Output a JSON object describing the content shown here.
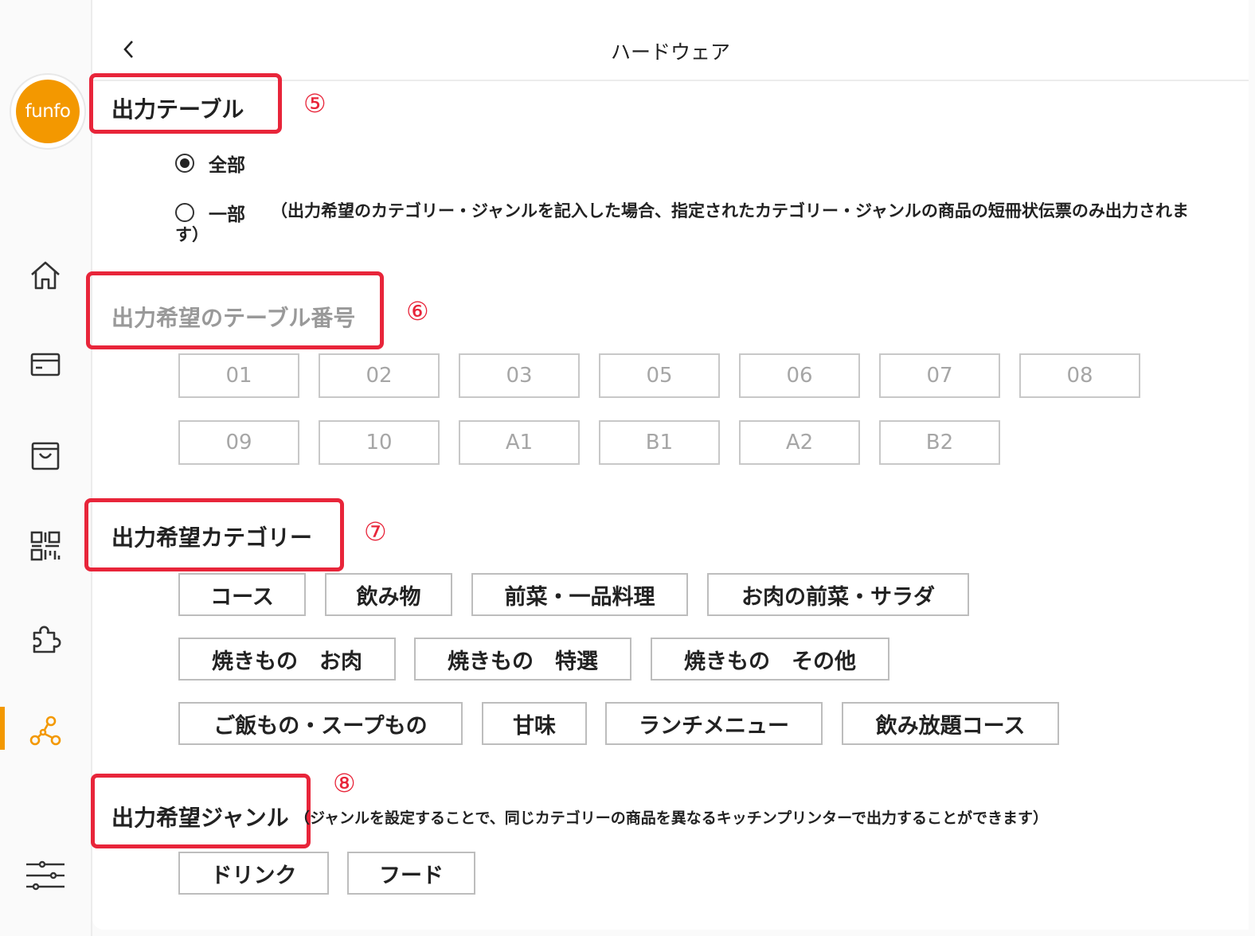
{
  "sidebar": {
    "logo_text": "funfo",
    "items": [
      {
        "icon": "home-icon"
      },
      {
        "icon": "card-icon"
      },
      {
        "icon": "bag-icon"
      },
      {
        "icon": "qr-code-icon"
      },
      {
        "icon": "puzzle-icon"
      },
      {
        "icon": "network-icon",
        "active": true
      },
      {
        "icon": "sliders-icon"
      }
    ],
    "accent": "#f39800"
  },
  "header": {
    "title": "ハードウェア"
  },
  "output_table": {
    "title": "出力テーブル",
    "marker": "⑤",
    "options": {
      "all": "全部",
      "partial": "一部"
    },
    "selected": "全部",
    "partial_note_line1": "（出力希望のカテゴリー・ジャンルを記入した場合、指定されたカテゴリー・ジャンルの商品の短冊状伝票のみ出力されま",
    "partial_note_line2": "す）"
  },
  "table_numbers": {
    "title": "出力希望のテーブル番号",
    "marker": "⑥",
    "items": [
      "01",
      "02",
      "03",
      "05",
      "06",
      "07",
      "08",
      "09",
      "10",
      "A1",
      "B1",
      "A2",
      "B2"
    ]
  },
  "categories": {
    "title": "出力希望カテゴリー",
    "marker": "⑦",
    "items": [
      "コース",
      "飲み物",
      "前菜・一品料理",
      "お肉の前菜・サラダ",
      "焼きもの　お肉",
      "焼きもの　特選",
      "焼きもの　その他",
      "ご飯もの・スープもの",
      "甘味",
      "ランチメニュー",
      "飲み放題コース"
    ]
  },
  "genres": {
    "title": "出力希望ジャンル",
    "marker": "⑧",
    "note": "（ジャンルを設定することで、同じカテゴリーの商品を異なるキッチンプリンターで出力することができます）",
    "items": [
      "ドリンク",
      "フード"
    ]
  },
  "colors": {
    "highlight_box": "#e8253a",
    "accent": "#f39800"
  }
}
